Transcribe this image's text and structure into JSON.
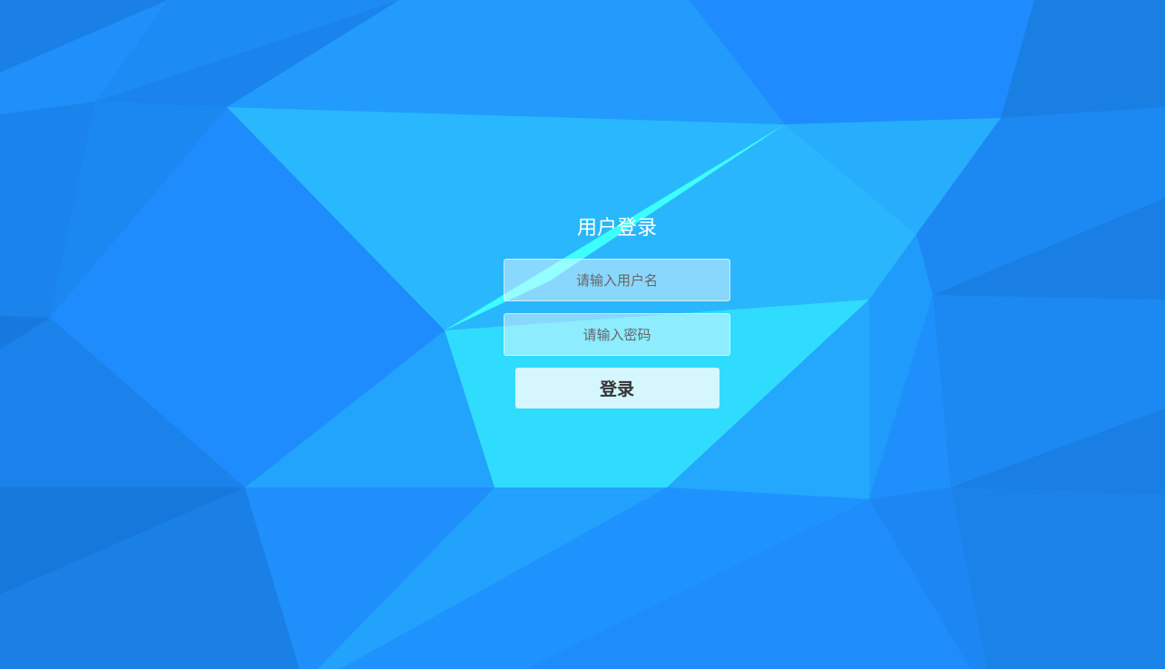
{
  "login": {
    "title": "用户登录",
    "username_placeholder": "请输入用户名",
    "password_placeholder": "请输入密码",
    "submit_label": "登录"
  },
  "colors": {
    "background": "#1e8cf5",
    "title_text": "#ffffff",
    "button_bg": "#d5f6fd"
  }
}
